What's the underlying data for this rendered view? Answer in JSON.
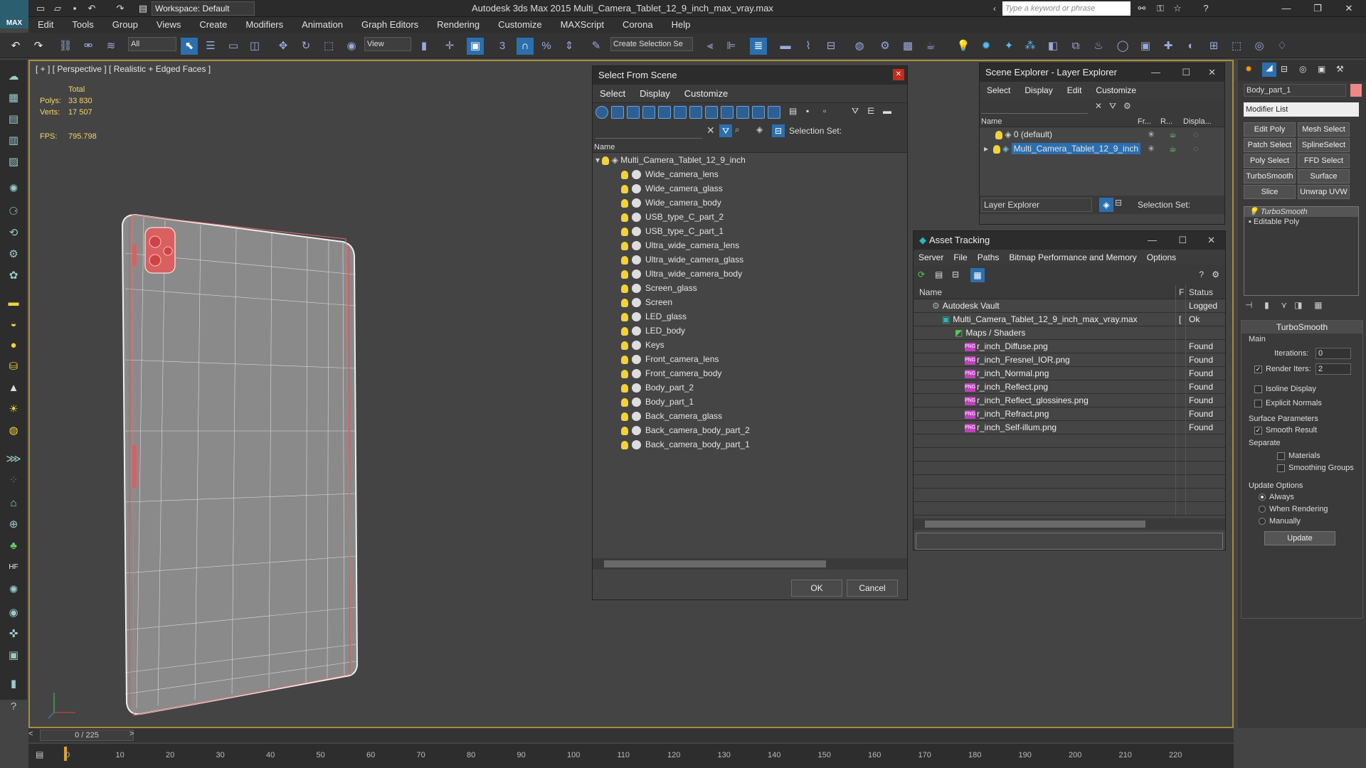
{
  "titlebar": {
    "workspace": "Workspace: Default",
    "title": "Autodesk 3ds Max  2015    Multi_Camera_Tablet_12_9_inch_max_vray.max",
    "search_placeholder": "Type a keyword or phrase",
    "logo": "MAX"
  },
  "menu": [
    "Edit",
    "Tools",
    "Group",
    "Views",
    "Create",
    "Modifiers",
    "Animation",
    "Graph Editors",
    "Rendering",
    "Customize",
    "MAXScript",
    "Corona",
    "Help"
  ],
  "toolbar": {
    "filter": "All",
    "refcoord": "View",
    "selection_set": "Create Selection Se"
  },
  "viewport": {
    "label": "[ + ] [ Perspective ] [ Realistic + Edged Faces ]",
    "stats_header": "Total",
    "polys_label": "Polys:",
    "polys": "33 830",
    "verts_label": "Verts:",
    "verts": "17 507",
    "fps_label": "FPS:",
    "fps": "795.798"
  },
  "select_dialog": {
    "title": "Select From Scene",
    "menu": [
      "Select",
      "Display",
      "Customize"
    ],
    "selection_set_label": "Selection Set:",
    "column": "Name",
    "root": "Multi_Camera_Tablet_12_9_inch",
    "items": [
      "Wide_camera_lens",
      "Wide_camera_glass",
      "Wide_camera_body",
      "USB_type_C_part_2",
      "USB_type_C_part_1",
      "Ultra_wide_camera_lens",
      "Ultra_wide_camera_glass",
      "Ultra_wide_camera_body",
      "Screen_glass",
      "Screen",
      "LED_glass",
      "LED_body",
      "Keys",
      "Front_camera_lens",
      "Front_camera_body",
      "Body_part_2",
      "Body_part_1",
      "Back_camera_glass",
      "Back_camera_body_part_2",
      "Back_camera_body_part_1"
    ],
    "ok": "OK",
    "cancel": "Cancel"
  },
  "scene_explorer": {
    "title": "Scene Explorer - Layer Explorer",
    "menu": [
      "Select",
      "Display",
      "Edit",
      "Customize"
    ],
    "columns": [
      "Name",
      "Fr...",
      "R...",
      "Displa..."
    ],
    "layers": [
      "0 (default)",
      "Multi_Camera_Tablet_12_9_inch"
    ],
    "footer_dropdown": "Layer Explorer",
    "selection_set_label": "Selection Set:"
  },
  "asset_tracking": {
    "title": "Asset Tracking",
    "menu": [
      "Server",
      "File",
      "Paths",
      "Bitmap Performance and Memory",
      "Options"
    ],
    "columns": [
      "Name",
      "F",
      "Status"
    ],
    "rows": [
      {
        "name": "Autodesk Vault",
        "f": "",
        "status": "Logged O"
      },
      {
        "name": "Multi_Camera_Tablet_12_9_inch_max_vray.max",
        "f": "[",
        "status": "Ok"
      },
      {
        "name": "Maps / Shaders",
        "f": "",
        "status": ""
      },
      {
        "name": "r_inch_Diffuse.png",
        "f": "",
        "status": "Found"
      },
      {
        "name": "r_inch_Fresnel_IOR.png",
        "f": "",
        "status": "Found"
      },
      {
        "name": "r_inch_Normal.png",
        "f": "",
        "status": "Found"
      },
      {
        "name": "r_inch_Reflect.png",
        "f": "",
        "status": "Found"
      },
      {
        "name": "r_inch_Reflect_glossines.png",
        "f": "",
        "status": "Found"
      },
      {
        "name": "r_inch_Refract.png",
        "f": "",
        "status": "Found"
      },
      {
        "name": "r_inch_Self-illum.png",
        "f": "",
        "status": "Found"
      }
    ]
  },
  "command_panel": {
    "object_name": "Body_part_1",
    "modifier_list": "Modifier List",
    "buttons": [
      "Edit Poly",
      "Mesh Select",
      "Patch Select",
      "SplineSelect",
      "Poly Select",
      "FFD Select",
      "TurboSmooth",
      "Surface Select",
      "Slice",
      "Unwrap UVW"
    ],
    "stack": [
      "TurboSmooth",
      "Editable Poly"
    ],
    "rollout": "TurboSmooth",
    "main": "Main",
    "iterations_label": "Iterations:",
    "iterations": "0",
    "render_iters_label": "Render Iters:",
    "render_iters": "2",
    "isoline": "Isoline Display",
    "explicit": "Explicit Normals",
    "surface_params": "Surface Parameters",
    "smooth_result": "Smooth Result",
    "separate": "Separate",
    "materials": "Materials",
    "smoothing_groups": "Smoothing Groups",
    "update_options": "Update Options",
    "always": "Always",
    "when_rendering": "When Rendering",
    "manually": "Manually",
    "update": "Update"
  },
  "timeline": {
    "frame": "0 / 225",
    "ticks": [
      "0",
      "10",
      "20",
      "30",
      "40",
      "50",
      "60",
      "70",
      "80",
      "90",
      "100",
      "110",
      "120",
      "130",
      "140",
      "150",
      "160",
      "170",
      "180",
      "190",
      "200",
      "210",
      "220"
    ]
  }
}
